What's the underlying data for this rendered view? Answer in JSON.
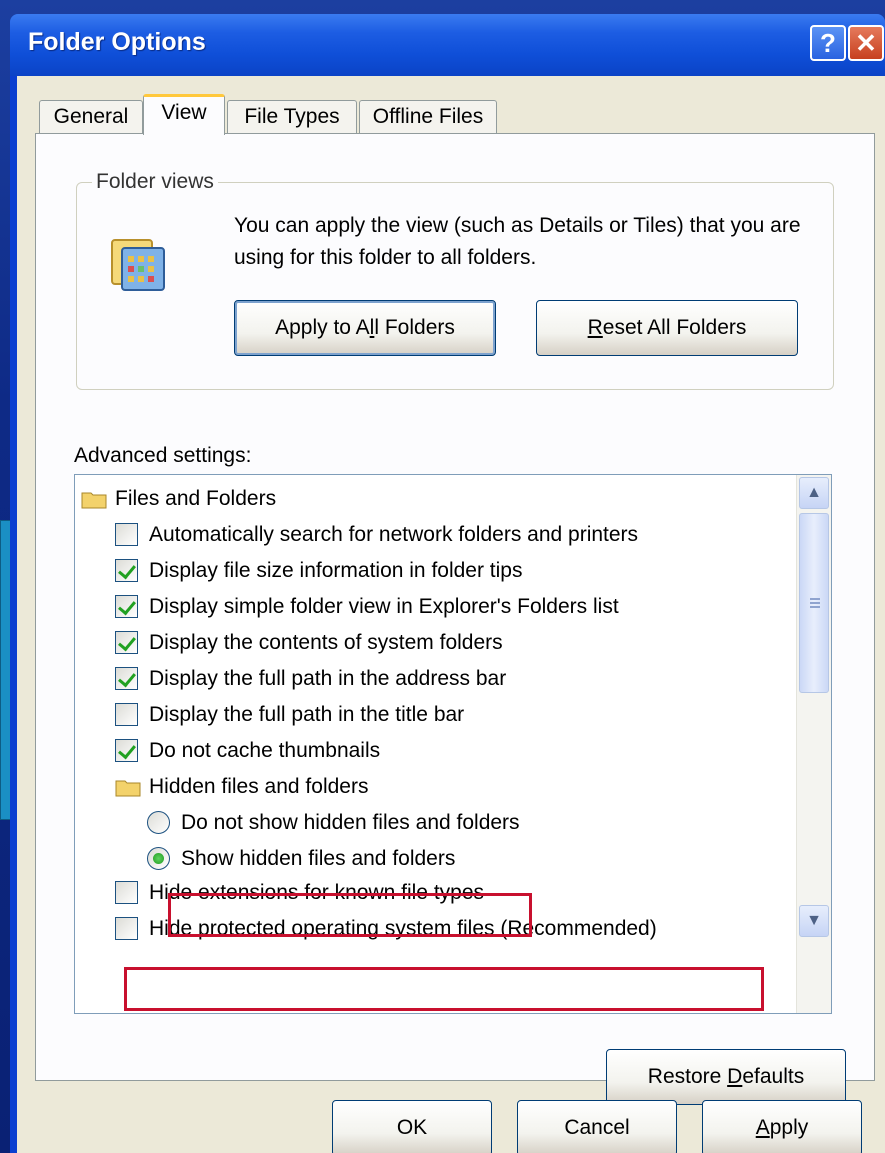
{
  "window": {
    "title": "Folder Options",
    "help_label": "?",
    "close_label": "✕"
  },
  "tabs": [
    {
      "label": "General"
    },
    {
      "label": "View"
    },
    {
      "label": "File Types"
    },
    {
      "label": "Offline Files"
    }
  ],
  "folder_views": {
    "group_label": "Folder views",
    "description": "You can apply the view (such as Details or Tiles) that you are using for this folder to all folders.",
    "apply_button": {
      "pre": "Apply to A",
      "accel": "l",
      "post": "l Folders"
    },
    "reset_button": {
      "pre": "",
      "accel": "R",
      "post": "eset All Folders"
    }
  },
  "advanced": {
    "label": "Advanced settings:",
    "items": [
      {
        "type": "folder",
        "label": "Files and Folders"
      },
      {
        "type": "checkbox",
        "checked": false,
        "label": "Automatically search for network folders and printers"
      },
      {
        "type": "checkbox",
        "checked": true,
        "label": "Display file size information in folder tips"
      },
      {
        "type": "checkbox",
        "checked": true,
        "label": "Display simple folder view in Explorer's Folders list"
      },
      {
        "type": "checkbox",
        "checked": true,
        "label": "Display the contents of system folders"
      },
      {
        "type": "checkbox",
        "checked": true,
        "label": "Display the full path in the address bar"
      },
      {
        "type": "checkbox",
        "checked": false,
        "label": "Display the full path in the title bar"
      },
      {
        "type": "checkbox",
        "checked": true,
        "label": "Do not cache thumbnails"
      },
      {
        "type": "folder",
        "label": "Hidden files and folders"
      },
      {
        "type": "radio",
        "checked": false,
        "label": "Do not show hidden files and folders"
      },
      {
        "type": "radio",
        "checked": true,
        "label": "Show hidden files and folders"
      },
      {
        "type": "checkbox",
        "checked": false,
        "label": "Hide extensions for known file types"
      },
      {
        "type": "checkbox",
        "checked": false,
        "label": "Hide protected operating system files (Recommended)"
      }
    ],
    "scroll_up": "▲",
    "scroll_down": "▼"
  },
  "restore_button": {
    "pre": "Restore ",
    "accel": "D",
    "post": "efaults"
  },
  "footer": {
    "ok_label": "OK",
    "cancel_label": "Cancel",
    "apply_button": {
      "pre": "",
      "accel": "A",
      "post": "pply"
    }
  },
  "colors": {
    "highlight": "#c8102e",
    "titlebar": "#0b43c6",
    "arrow": "#1a8fc4"
  }
}
